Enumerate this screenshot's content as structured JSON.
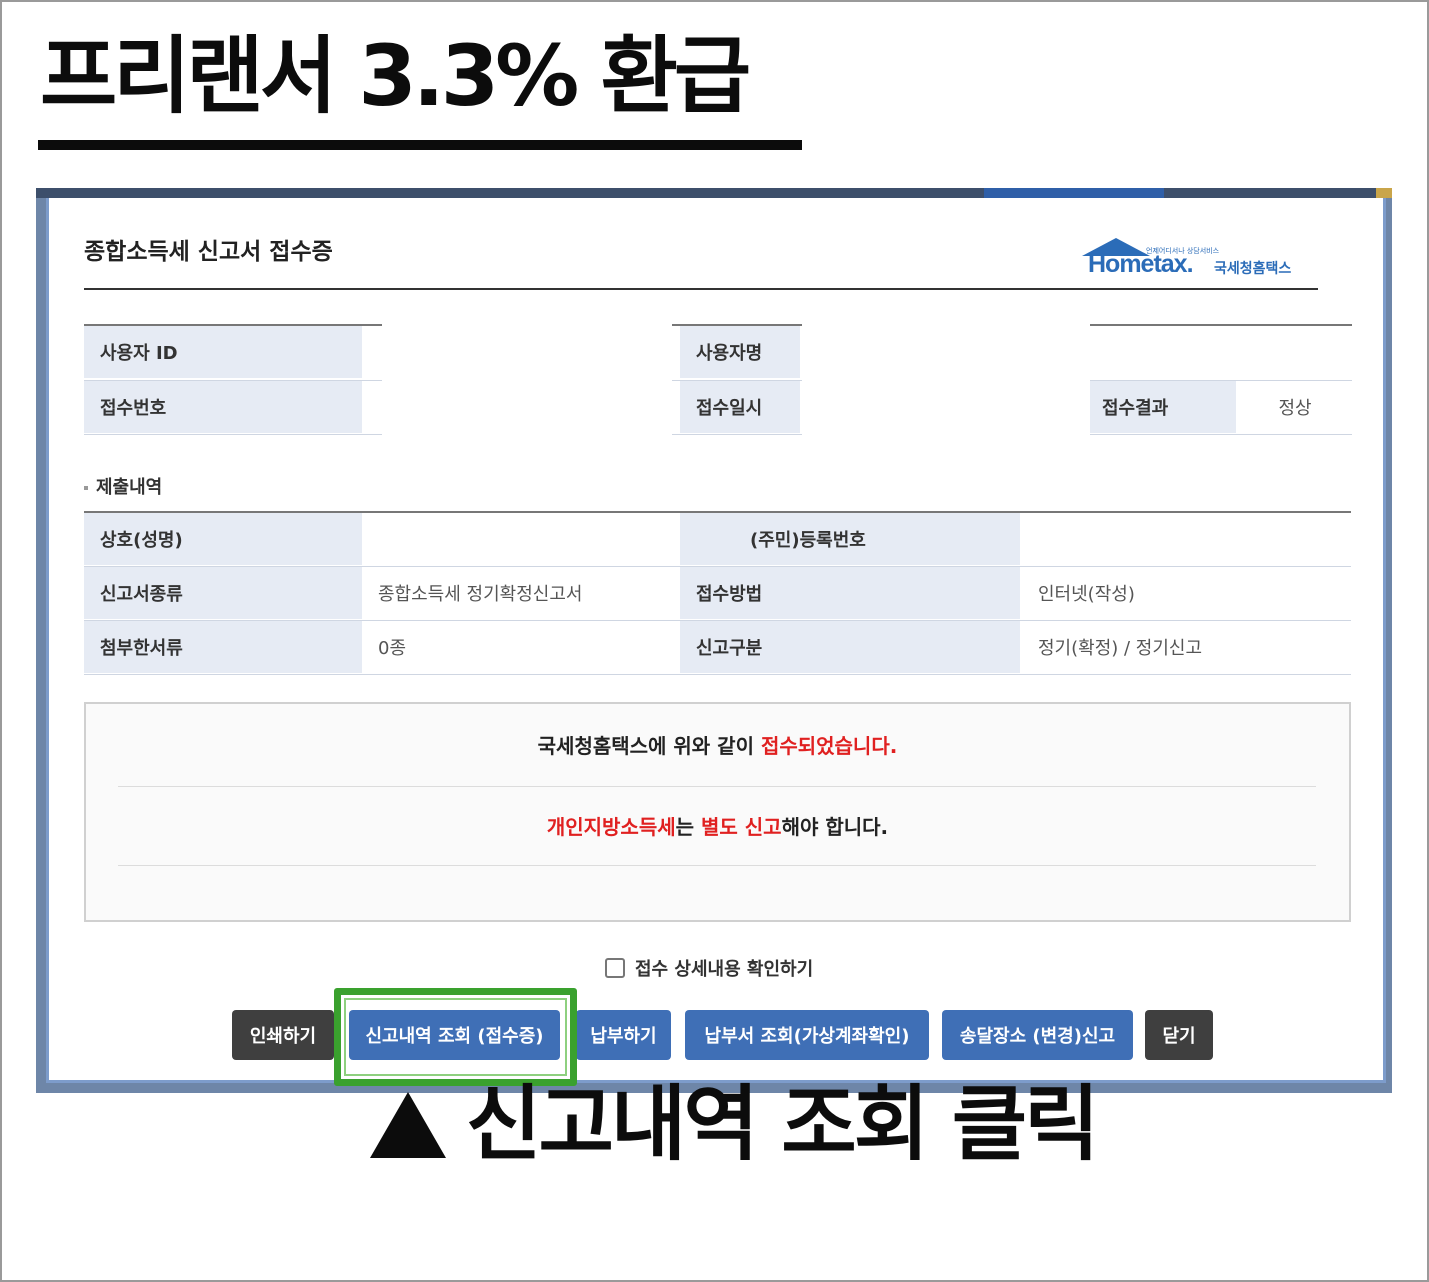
{
  "headline": "프리랜서 3.3% 환급",
  "dialog": {
    "title": "종합소득세 신고서 접수증",
    "logo": {
      "word": "Hometax.",
      "sub": "국세청홈택스",
      "tiny": "언제어디서나 상담서비스"
    },
    "user_table": {
      "user_id_label": "사용자 ID",
      "user_id_value": "",
      "user_name_label": "사용자명",
      "user_name_value": "",
      "receipt_no_label": "접수번호",
      "receipt_no_value": "",
      "receipt_time_label": "접수일시",
      "receipt_time_value": "",
      "result_label": "접수결과",
      "result_value": "정상"
    },
    "section_title": "제출내역",
    "submit_table": {
      "name_label": "상호(성명)",
      "name_value": "",
      "regno_label": "(주민)등록번호",
      "regno_value": "",
      "form_type_label": "신고서종류",
      "form_type_value": "종합소득세 정기확정신고서",
      "method_label": "접수방법",
      "method_value": "인터넷(작성)",
      "attach_label": "첨부한서류",
      "attach_value": "0종",
      "category_label": "신고구분",
      "category_value": "정기(확정) / 정기신고"
    },
    "notice": {
      "line1_prefix": "국세청홈택스에 위와 같이 ",
      "line1_red": "접수되었습니다.",
      "line2_red1": "개인지방소득세",
      "line2_mid1": "는 ",
      "line2_red2": "별도 신고",
      "line2_suffix": "해야 합니다."
    },
    "checkbox_label": "접수 상세내용 확인하기",
    "buttons": {
      "print": "인쇄하기",
      "history": "신고내역 조회 (접수증)",
      "pay": "납부하기",
      "bill": "납부서 조회(가상계좌확인)",
      "address": "송달장소 (변경)신고",
      "close": "닫기"
    }
  },
  "caption": "신고내역 조회 클릭",
  "colors": {
    "accent_blue": "#3f6fb6",
    "highlight_green": "#3aa12e",
    "notice_red": "#e02020"
  }
}
